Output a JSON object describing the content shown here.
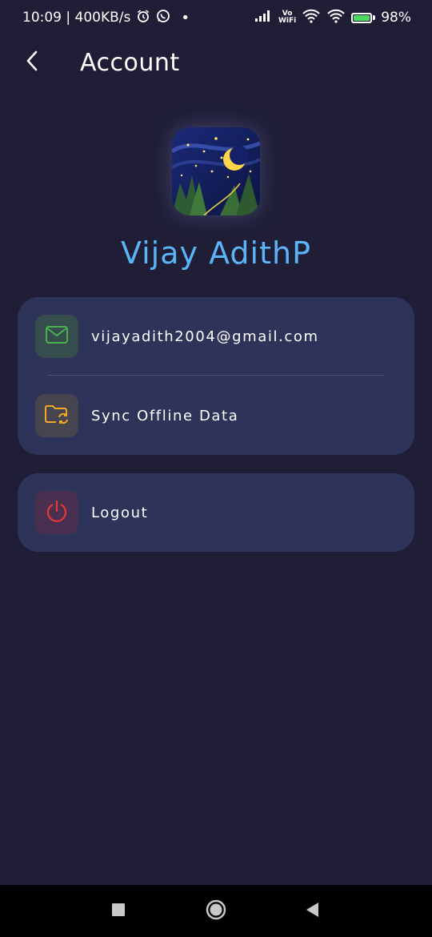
{
  "status_bar": {
    "time_speed": "10:09 | 400KB/s",
    "dot": "•",
    "vowifi_top": "Vo",
    "vowifi_bottom": "WiFi",
    "battery": "98%",
    "battery_color": "#4cd964"
  },
  "header": {
    "title": "Account",
    "back_icon": "chevron-left-icon"
  },
  "profile": {
    "avatar_image": "night-sky-moon-forest",
    "name": "Vijay AdithP",
    "name_color": "#5ab4f7"
  },
  "account_card": {
    "items": [
      {
        "icon": "mail-icon",
        "label": "vijayadith2004@gmail.com",
        "icon_color": "#4caf50"
      },
      {
        "icon": "folder-sync-icon",
        "label": "Sync Offline Data",
        "icon_color": "#f5a623"
      }
    ]
  },
  "logout_card": {
    "icon": "power-icon",
    "label": "Logout",
    "icon_color": "#e53935"
  },
  "colors": {
    "background": "#1f1e36",
    "card": "#2e335a",
    "accent": "#5ab4f7"
  },
  "nav_bar": {
    "recents_icon": "square-icon",
    "home_icon": "circle-icon",
    "back_icon": "triangle-back-icon"
  }
}
